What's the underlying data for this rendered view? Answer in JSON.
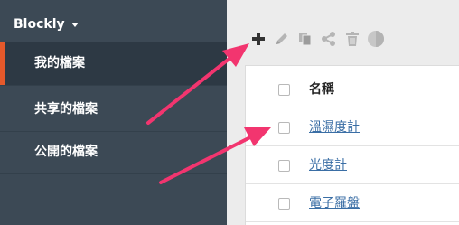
{
  "sidebar": {
    "brand": "Blockly",
    "items": [
      {
        "label": "我的檔案",
        "active": true
      },
      {
        "label": "共享的檔案",
        "active": false
      },
      {
        "label": "公開的檔案",
        "active": false
      }
    ]
  },
  "toolbar": {
    "icons": [
      "plus-icon",
      "pencil-icon",
      "copy-icon",
      "share-icon",
      "trash-icon",
      "circle-icon"
    ]
  },
  "table": {
    "header": "名稱",
    "rows": [
      "溫濕度計",
      "光度計",
      "電子羅盤"
    ]
  },
  "colors": {
    "sidebar": "#3c4955",
    "sidebar_active": "#2d3944",
    "accent": "#e5592b",
    "link": "#3a6ea5",
    "arrow": "#f2356f"
  }
}
